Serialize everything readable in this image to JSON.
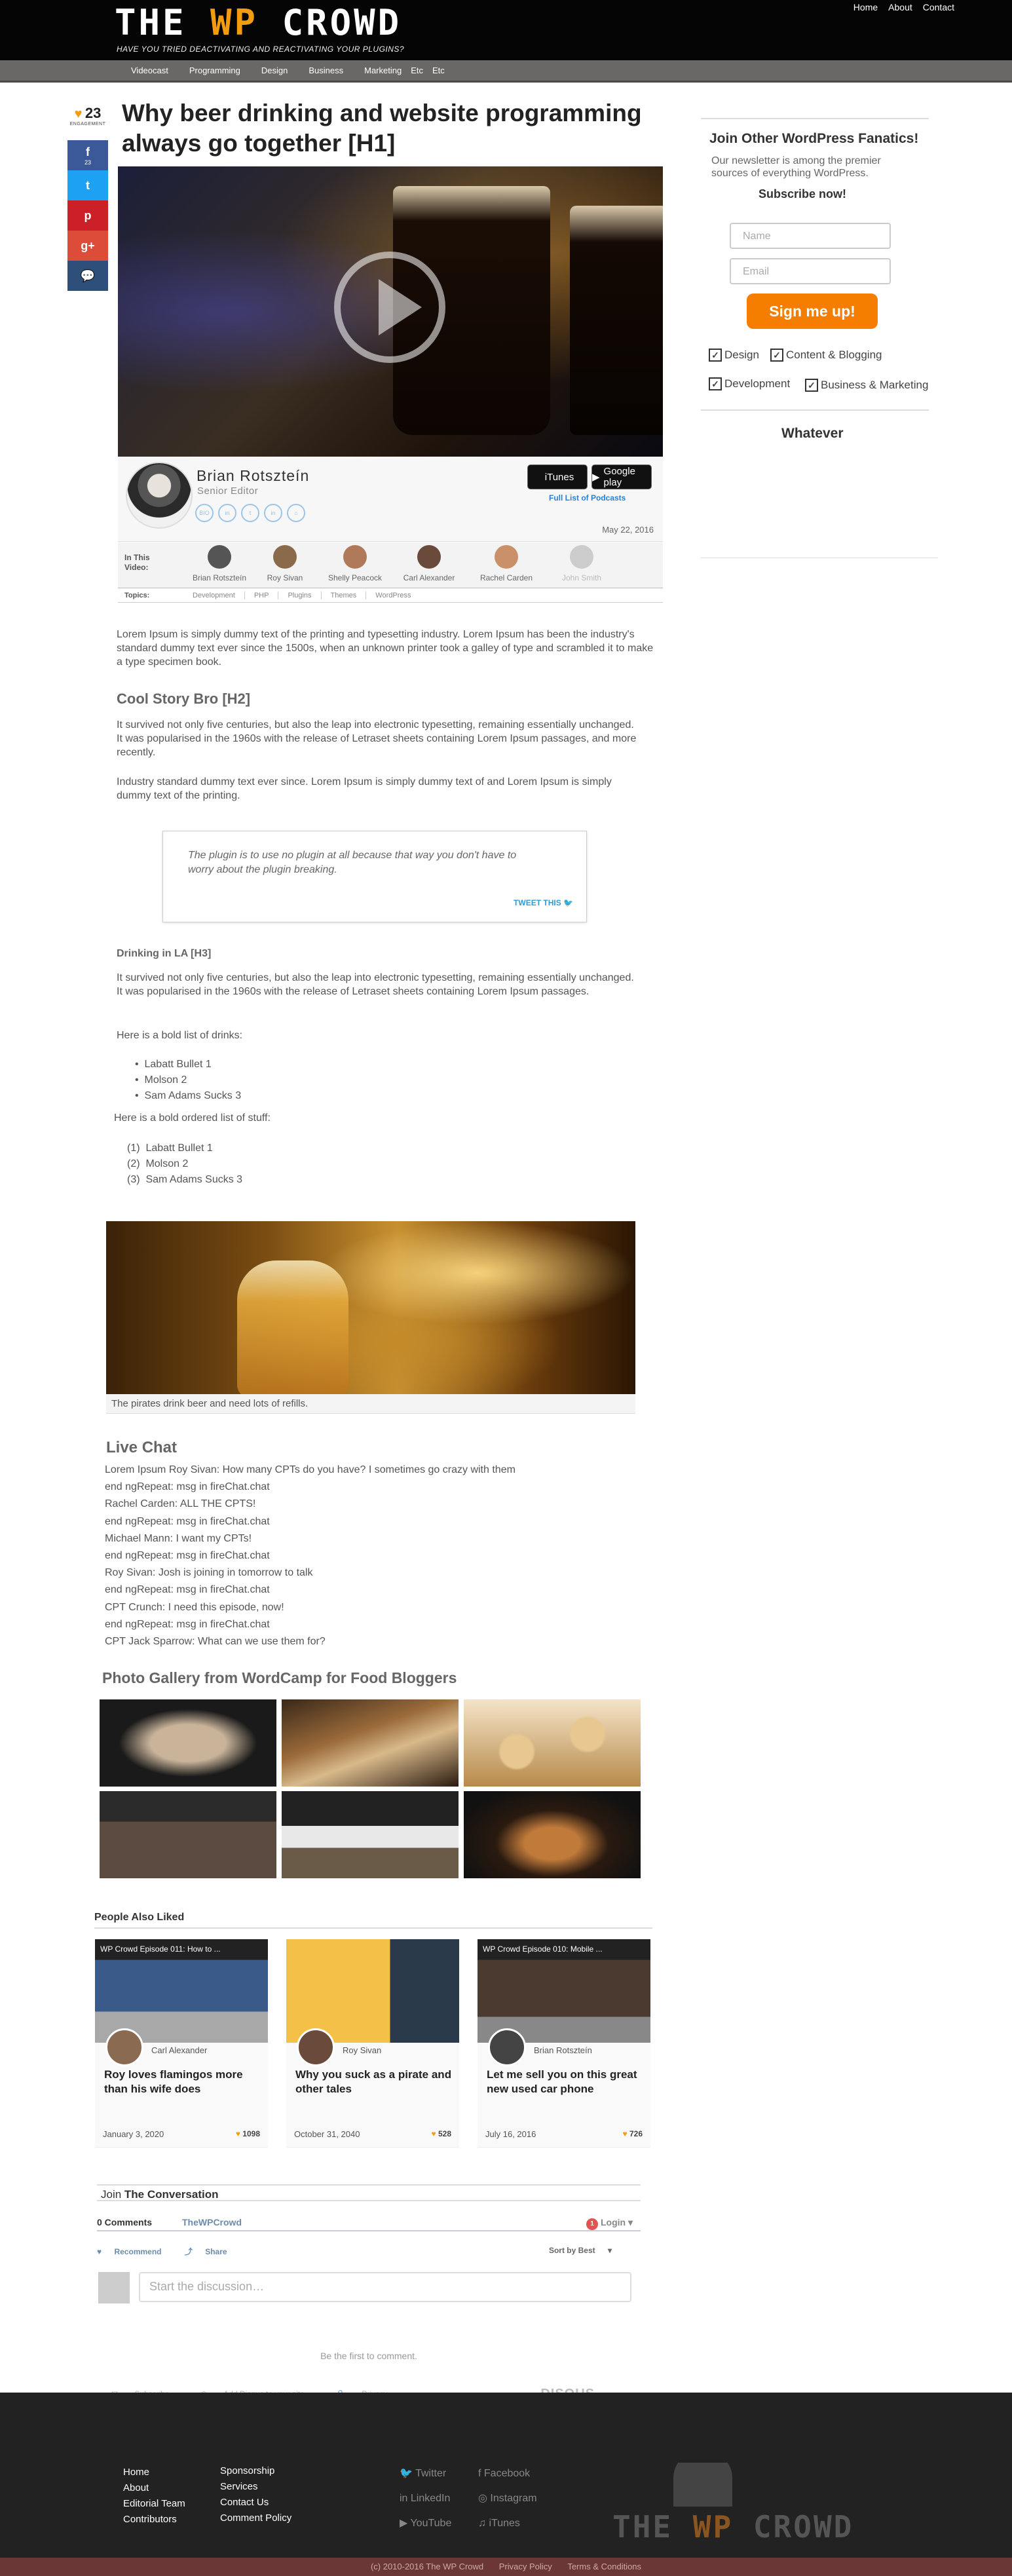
{
  "header": {
    "logo_pre": "THE ",
    "logo_wp": "WP",
    "logo_post": " CROWD",
    "tagline": "HAVE YOU TRIED DEACTIVATING AND REACTIVATING  YOUR PLUGINS?",
    "top_links": [
      "Home",
      "About",
      "Contact"
    ],
    "categories": [
      "Videocast",
      "Programming",
      "Design",
      "Business",
      "Marketing",
      "Etc",
      "Etc"
    ]
  },
  "share": {
    "engagement": "23",
    "engagement_label": "ENGAGEMENT",
    "facebook_count": "23",
    "buttons": [
      {
        "icon": "facebook-icon",
        "glyph": "f",
        "color": "#3b5998"
      },
      {
        "icon": "twitter-icon",
        "glyph": "t",
        "color": "#1da1f2"
      },
      {
        "icon": "pinterest-icon",
        "glyph": "p",
        "color": "#cb2027"
      },
      {
        "icon": "google-plus-icon",
        "glyph": "g+",
        "color": "#dd4b39"
      },
      {
        "icon": "comment-icon",
        "glyph": "…",
        "color": "#2e4f7a"
      }
    ]
  },
  "article": {
    "title": "Why beer drinking and website programming always go together [H1]",
    "author_name": "Brian Rotszteín",
    "author_role": "Senior Editor",
    "author_social": [
      "BIO",
      "in",
      "t",
      "in",
      "⌂"
    ],
    "store_buttons": [
      "iTunes",
      "Google play"
    ],
    "podcast_link": "Full List of Podcasts",
    "date": "May 22, 2016",
    "in_this_video_label": "In This Video:",
    "cast": [
      {
        "name": "Brian Rotszteín",
        "color": "#555"
      },
      {
        "name": "Roy Sivan",
        "color": "#8a6a4a"
      },
      {
        "name": "Shelly Peacock",
        "color": "#b07a5a"
      },
      {
        "name": "Carl Alexander",
        "color": "#6a4a3a"
      },
      {
        "name": "Rachel Carden",
        "color": "#c9906a"
      },
      {
        "name": "John Smith",
        "color": "#ccc"
      }
    ],
    "topics_label": "Topics:",
    "topics": [
      "Development",
      "PHP",
      "Plugins",
      "Themes",
      "WordPress"
    ],
    "intro": "Lorem Ipsum is simply dummy text of the printing and typesetting industry. Lorem Ipsum has been the industry's standard dummy text ever since the 1500s, when an unknown printer took a galley of type and scrambled it to make a type specimen book.",
    "h2": "Cool Story Bro [H2]",
    "p2": "It survived not only five centuries, but also the leap into electronic typesetting, remaining essentially unchanged. It was popularised in the 1960s with the release of Letraset sheets containing Lorem Ipsum passages, and more recently.",
    "p3": "Industry standard dummy text ever since. Lorem Ipsum is simply dummy text of and Lorem Ipsum is simply dummy text of the printing.",
    "quote": "The plugin is to use no plugin at all because that way you don't have to worry about the plugin breaking.",
    "tweet_this": "TWEET THIS",
    "h3": "Drinking in LA [H3]",
    "p4": "It survived not only five centuries, but also the leap into electronic typesetting, remaining essentially unchanged. It was popularised in the 1960s with the release of Letraset sheets containing Lorem Ipsum passages.",
    "bold_list_label": "Here is a bold list of drinks:",
    "bullets": [
      "Labatt Bullet 1",
      "Molson 2",
      "Sam Adams Sucks 3"
    ],
    "ordered_list_label": "Here is a bold ordered list of stuff:",
    "ordered": [
      "Labatt Bullet 1",
      "Molson 2",
      "Sam Adams Sucks 3"
    ],
    "photo_caption": "The pirates drink beer and need lots of refills."
  },
  "live_chat": {
    "title": "Live Chat",
    "lines": [
      "Lorem Ipsum Roy Sivan: How many CPTs do you have? I sometimes go crazy with them",
      "end ngRepeat: msg in fireChat.chat",
      "Rachel Carden: ALL THE CPTS!",
      "end ngRepeat: msg in fireChat.chat",
      "Michael Mann: I want my CPTs!",
      "end ngRepeat: msg in fireChat.chat",
      "Roy Sivan: Josh is joining in tomorrow to talk",
      "end ngRepeat: msg in fireChat.chat",
      "CPT Crunch: I need this episode, now!",
      "end ngRepeat: msg in fireChat.chat",
      "CPT Jack Sparrow: What can we use them for?"
    ]
  },
  "gallery": {
    "title": "Photo Gallery from WordCamp for Food Bloggers"
  },
  "people_also_liked": {
    "title": "People Also Liked",
    "cards": [
      {
        "thumb_title": "WP Crowd Episode 011: How to ...",
        "author": "Carl Alexander",
        "headline": "Roy loves flamingos more than his wife does",
        "date": "January 3, 2020",
        "likes": "1098"
      },
      {
        "thumb_title": "",
        "author": "Roy Sivan",
        "headline": "Why you suck as a pirate and other tales",
        "date": "October 31, 2040",
        "likes": "528"
      },
      {
        "thumb_title": "WP Crowd Episode 010: Mobile ...",
        "author": "Brian Rotszteín",
        "headline": "Let me sell you on this great new used car phone",
        "date": "July 16, 2016",
        "likes": "726"
      }
    ]
  },
  "comments": {
    "join": "Join",
    "join_rest": " The Conversation",
    "count_tab": "0 Comments",
    "site_tab": "TheWPCrowd",
    "login": "Login",
    "recommend": "Recommend",
    "share": "Share",
    "sort": "Sort by Best",
    "placeholder": "Start the discussion…",
    "first": "Be the first to comment.",
    "footer_links": [
      "Subscribe",
      "Add Disqus to your site",
      "Privacy"
    ],
    "brand": "DISQUS"
  },
  "sidebar": {
    "title": "Join Other WordPress Fanatics!",
    "desc": "Our newsletter is among the premier sources of everything WordPress.",
    "subscribe": "Subscribe now!",
    "name_placeholder": "Name",
    "email_placeholder": "Email",
    "signup": "Sign me up!",
    "checks": [
      "Design",
      "Content & Blogging",
      "Development",
      "Business & Marketing"
    ],
    "widget_title": "Whatever"
  },
  "footer": {
    "col1": [
      "Home",
      "About",
      "Editorial Team",
      "Contributors"
    ],
    "col2": [
      "Sponsorship",
      "Services",
      "Contact Us",
      "Comment Policy"
    ],
    "social1": [
      "Twitter",
      "LinkedIn",
      "YouTube"
    ],
    "social2": [
      "Facebook",
      "Instagram",
      "iTunes"
    ],
    "copyright": "(c) 2010-2016 The WP Crowd",
    "privacy": "Privacy Policy",
    "terms": "Terms & Conditions"
  }
}
